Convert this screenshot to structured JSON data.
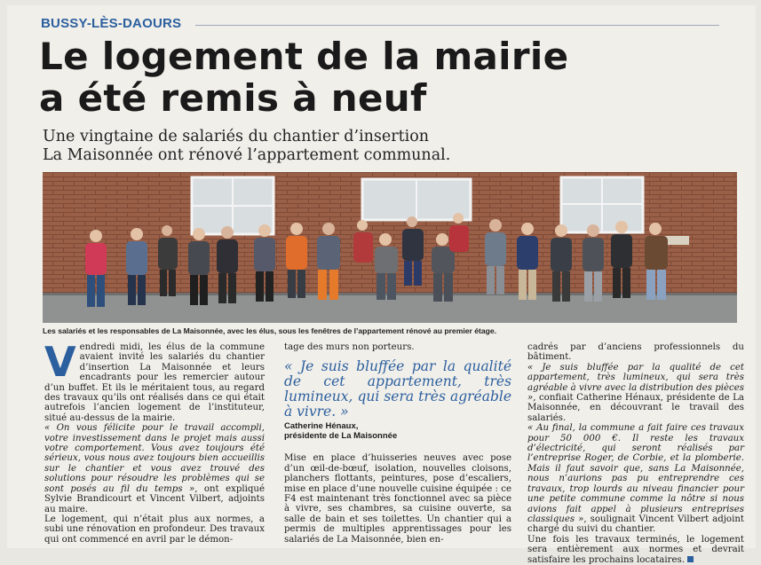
{
  "article": {
    "locality": "BUSSY-LÈS-DAOURS",
    "headline_line1": "Le logement de la mairie",
    "headline_line2": "a été remis à neuf",
    "subhead_line1": "Une vingtaine de salariés du chantier d’insertion",
    "subhead_line2": "La Maisonnée ont rénové l’appartement communal.",
    "photo_caption": "Les salariés et les responsables de La Maisonnée, avec les élus, sous les fenêtres de l’appartement rénové au premier étage.",
    "col1": {
      "dropcap": "V",
      "p1": "endredi midi, les élus de la commune avaient invité les salariés du chantier d’insertion La Maisonnée et leurs encadrants pour les remercier autour d’un buffet. Et ils le méritaient tous, au regard des travaux qu’ils ont réalisés dans ce qui était autrefois l’ancien logement de l’instituteur, situé au-dessus de la mairie.",
      "p2_italic": "« On vous félicite pour le travail accompli, votre investissement dans le projet mais aussi votre comportement. Vous avez toujours été sérieux, vous nous avez toujours bien accueillis sur le chantier et vous avez trouvé des solutions pour résoudre les problèmes qui se sont posés au fil du temps »",
      "p2_rest": ", ont expliqué Sylvie Brandicourt et Vincent Vilbert, adjoints au maire.",
      "p3": "Le logement, qui n’était plus aux normes, a subi une rénovation en profondeur. Des travaux qui ont commencé en avril par le démon-"
    },
    "col2": {
      "p1": "tage des murs non porteurs.",
      "quote": "« Je suis bluffée par la qualité de cet appartement, très lumineux, qui sera très agréable à vivre. »",
      "quote_author": "Catherine Hénaux,",
      "quote_role": "présidente de La Maisonnée",
      "p2": "Mise en place d’huisseries neuves avec pose d’un œil-de-bœuf, isolation, nouvelles cloisons, planchers flottants, peintures, pose d’escaliers, mise en place d’une nouvelle cuisine équipée : ce F4 est maintenant très fonctionnel avec sa pièce à vivre, ses chambres, sa cuisine ouverte, sa salle de bain et ses toilettes. Un chantier qui a permis de multiples apprentissages pour les salariés de La Maisonnée, bien en-"
    },
    "col3": {
      "p1": "cadrés par d’anciens professionnels du bâtiment.",
      "p2_italic": "« Je suis bluffée par la qualité de cet appartement, très lumineux, qui sera très agréable à vivre avec la distribution des pièces »",
      "p2_rest": ", confiait Catherine Hénaux, présidente de La Maisonnée, en découvrant le travail des salariés.",
      "p3_italic": "« Au final, la commune a fait faire ces travaux pour 50 000 €. Il reste les travaux d’électricité, qui seront réalisés par l’entreprise Roger, de Corbie, et la plomberie. Mais il faut savoir que, sans La Maisonnée, nous n’aurions pas pu entreprendre ces travaux, trop lourds au niveau financier pour une petite commune comme la nôtre si nous avions fait appel à plusieurs entreprises classiques »",
      "p3_rest": ", soulignait Vincent Vilbert adjoint chargé du suivi du chantier.",
      "p4": "Une fois les travaux terminés, le logement sera entièrement aux normes et devrait satisfaire les prochains locataires."
    }
  },
  "colors": {
    "accent": "#2b5f9e",
    "text": "#1d1d1d",
    "paper": "#f1efea"
  }
}
